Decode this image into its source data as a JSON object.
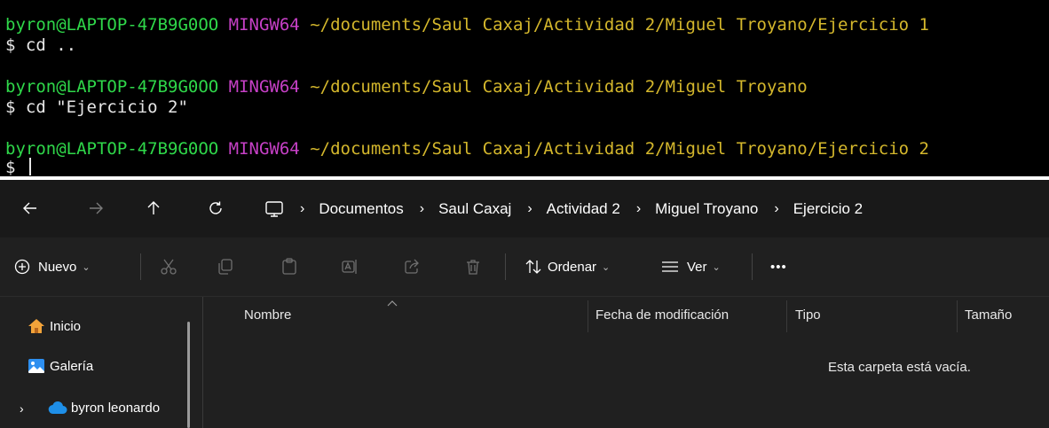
{
  "terminal": {
    "blocks": [
      {
        "user": "byron@LAPTOP-47B9G0OO",
        "system": "MINGW64",
        "path": "~/documents/Saul Caxaj/Actividad 2/Miguel Troyano/Ejercicio 1",
        "command": "$ cd .."
      },
      {
        "user": "byron@LAPTOP-47B9G0OO",
        "system": "MINGW64",
        "path": "~/documents/Saul Caxaj/Actividad 2/Miguel Troyano",
        "command": "$ cd \"Ejercicio 2\""
      },
      {
        "user": "byron@LAPTOP-47B9G0OO",
        "system": "MINGW64",
        "path": "~/documents/Saul Caxaj/Actividad 2/Miguel Troyano/Ejercicio 2",
        "command": "$ "
      }
    ]
  },
  "explorer": {
    "breadcrumbs": [
      "Documentos",
      "Saul Caxaj",
      "Actividad 2",
      "Miguel Troyano",
      "Ejercicio 2"
    ],
    "toolbar": {
      "new_label": "Nuevo",
      "sort_label": "Ordenar",
      "view_label": "Ver",
      "more_label": "•••"
    },
    "sidebar": {
      "items": [
        {
          "label": "Inicio",
          "icon": "home-icon"
        },
        {
          "label": "Galería",
          "icon": "gallery-icon"
        },
        {
          "label": "byron leonardo",
          "icon": "onedrive-cloud-icon"
        }
      ]
    },
    "columns": [
      "Nombre",
      "Fecha de modificación",
      "Tipo",
      "Tamaño"
    ],
    "empty_message": "Esta carpeta está vacía."
  },
  "colors": {
    "terminal_bg": "#000000",
    "terminal_user": "#2fd84a",
    "terminal_system": "#c640c6",
    "terminal_path": "#d4b72c",
    "explorer_bg": "#202020"
  }
}
